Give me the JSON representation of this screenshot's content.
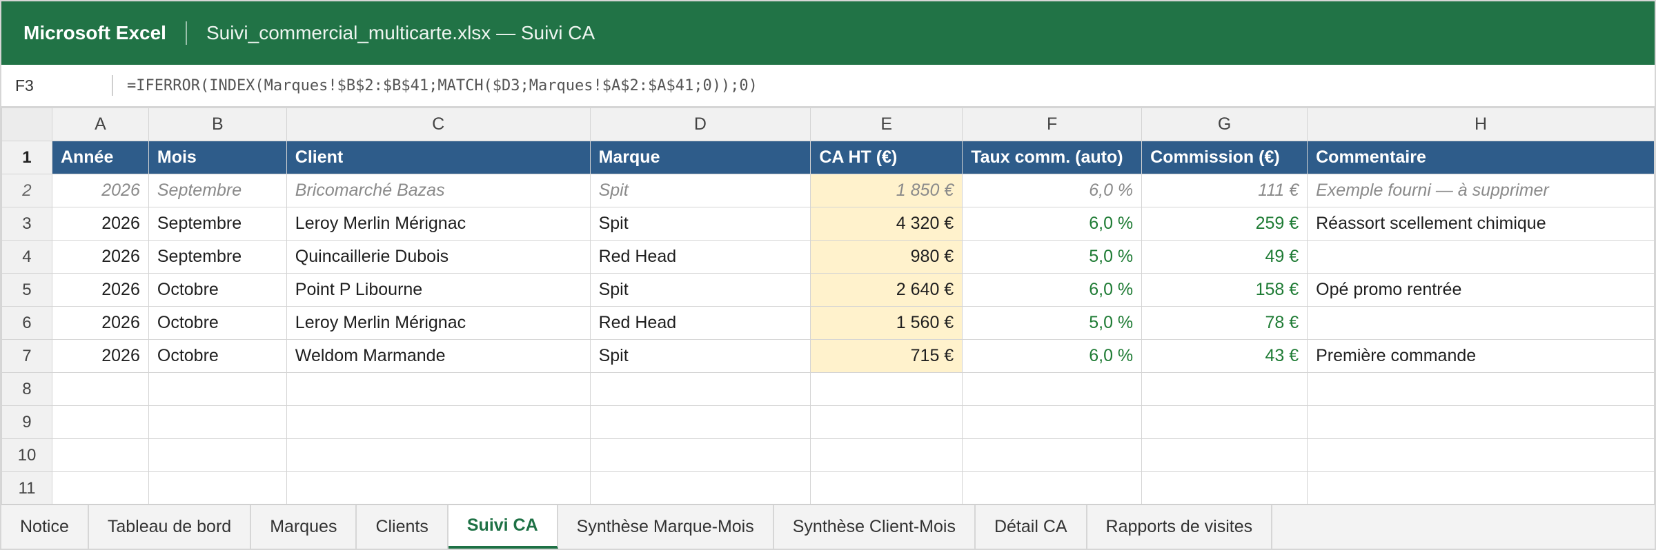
{
  "app": {
    "name": "Microsoft Excel",
    "document_title": "Suivi_commercial_multicarte.xlsx — Suivi CA"
  },
  "formula_bar": {
    "cell_ref": "F3",
    "formula": "=IFERROR(INDEX(Marques!$B$2:$B$41;MATCH($D3;Marques!$A$2:$A$41;0));0)"
  },
  "columns": [
    "A",
    "B",
    "C",
    "D",
    "E",
    "F",
    "G",
    "H"
  ],
  "header_row": {
    "row_num": "1",
    "cells": [
      "Année",
      "Mois",
      "Client",
      "Marque",
      "CA HT (€)",
      "Taux comm. (auto)",
      "Commission (€)",
      "Commentaire"
    ]
  },
  "rows": [
    {
      "row_num": "2",
      "cells": [
        "2026",
        "Septembre",
        "Bricomarché Bazas",
        "Spit",
        "1 850 €",
        "6,0 %",
        "111 €",
        "Exemple fourni — à supprimer"
      ]
    },
    {
      "row_num": "3",
      "cells": [
        "2026",
        "Septembre",
        "Leroy Merlin Mérignac",
        "Spit",
        "4 320 €",
        "6,0 %",
        "259 €",
        "Réassort scellement chimique"
      ]
    },
    {
      "row_num": "4",
      "cells": [
        "2026",
        "Septembre",
        "Quincaillerie Dubois",
        "Red Head",
        "980 €",
        "5,0 %",
        "49 €",
        ""
      ]
    },
    {
      "row_num": "5",
      "cells": [
        "2026",
        "Octobre",
        "Point P Libourne",
        "Spit",
        "2 640 €",
        "6,0 %",
        "158 €",
        "Opé promo rentrée"
      ]
    },
    {
      "row_num": "6",
      "cells": [
        "2026",
        "Octobre",
        "Leroy Merlin Mérignac",
        "Red Head",
        "1 560 €",
        "5,0 %",
        "78 €",
        ""
      ]
    },
    {
      "row_num": "7",
      "cells": [
        "2026",
        "Octobre",
        "Weldom Marmande",
        "Spit",
        "715 €",
        "6,0 %",
        "43 €",
        "Première commande"
      ]
    },
    {
      "row_num": "8",
      "cells": [
        "",
        "",
        "",
        "",
        "",
        "",
        "",
        ""
      ]
    },
    {
      "row_num": "9",
      "cells": [
        "",
        "",
        "",
        "",
        "",
        "",
        "",
        ""
      ]
    },
    {
      "row_num": "10",
      "cells": [
        "",
        "",
        "",
        "",
        "",
        "",
        "",
        ""
      ]
    },
    {
      "row_num": "11",
      "cells": [
        "",
        "",
        "",
        "",
        "",
        "",
        "",
        ""
      ]
    }
  ],
  "sheet_tabs": [
    "Notice",
    "Tableau de bord",
    "Marques",
    "Clients",
    "Suivi CA",
    "Synthèse Marque-Mois",
    "Synthèse Client-Mois",
    "Détail CA",
    "Rapports de visites"
  ],
  "active_tab": "Suivi CA",
  "colors": {
    "title_bar": "#217346",
    "header_fill": "#2e5c8a",
    "ca_input_fill": "#fff2cc",
    "auto_formula_text": "#1e7b34",
    "example_row_text": "#8a8a8a"
  }
}
